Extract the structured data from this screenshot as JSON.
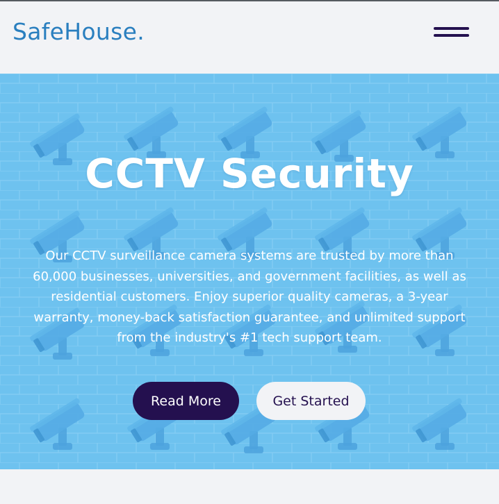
{
  "header": {
    "logo": "SafeHouse.",
    "menu_icon": "hamburger-menu-icon"
  },
  "hero": {
    "title": "CCTV Security",
    "description": "Our CCTV surveillance camera systems are trusted by more than 60,000 businesses, universities, and government facilities, as well as residential customers. Enjoy superior quality cameras, a 3-year warranty, money-back satisfaction guarantee, and unlimited support from the industry's #1 tech support team.",
    "background_image": "brick-wall-with-security-cameras"
  },
  "buttons": {
    "read_more": "Read More",
    "get_started": "Get Started"
  },
  "colors": {
    "brand_text": "#2a7fbf",
    "dark_accent": "#24104f",
    "hero_blue": "#6ec3ef",
    "page_bg": "#f2f3f6"
  }
}
